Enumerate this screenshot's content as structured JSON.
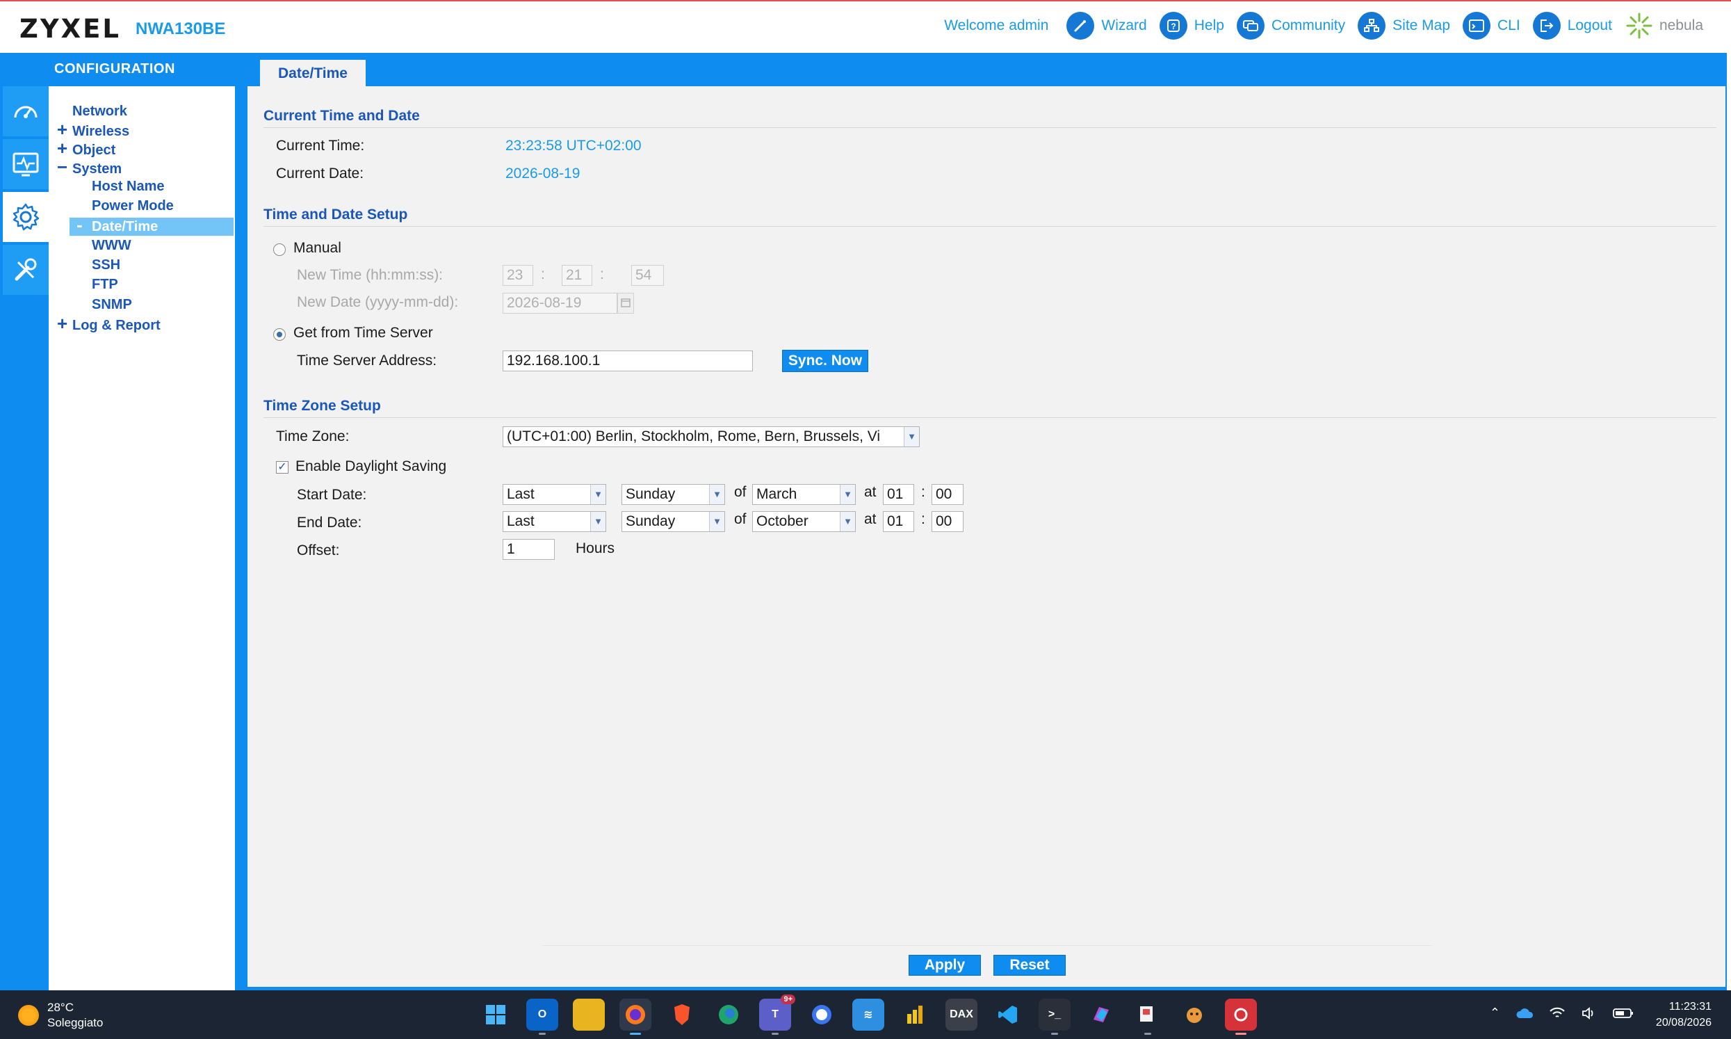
{
  "header": {
    "brand": "ZYXEL",
    "model": "NWA130BE",
    "welcome": "Welcome admin",
    "nav": [
      {
        "label": "Wizard",
        "icon": "wand-icon"
      },
      {
        "label": "Help",
        "icon": "help-icon"
      },
      {
        "label": "Community",
        "icon": "chat-icon"
      },
      {
        "label": "Site Map",
        "icon": "sitemap-icon"
      },
      {
        "label": "CLI",
        "icon": "terminal-icon"
      },
      {
        "label": "Logout",
        "icon": "logout-icon"
      }
    ],
    "nebula": "nebula"
  },
  "sidebar": {
    "title": "CONFIGURATION",
    "tree": [
      {
        "label": "Network",
        "sign": ""
      },
      {
        "label": "Wireless",
        "sign": "+"
      },
      {
        "label": "Object",
        "sign": "+"
      },
      {
        "label": "System",
        "sign": "−"
      },
      {
        "label": "Host Name",
        "sign": ""
      },
      {
        "label": "Power Mode",
        "sign": ""
      },
      {
        "label": "Date/Time",
        "sign": "-"
      },
      {
        "label": "WWW",
        "sign": ""
      },
      {
        "label": "SSH",
        "sign": ""
      },
      {
        "label": "FTP",
        "sign": ""
      },
      {
        "label": "SNMP",
        "sign": ""
      },
      {
        "label": "Log & Report",
        "sign": "+"
      }
    ]
  },
  "tab": "Date/Time",
  "current": {
    "section": "Current Time and Date",
    "time_label": "Current Time:",
    "time_value": "23:23:58 UTC+02:00",
    "date_label": "Current Date:",
    "date_value": "2026-08-19"
  },
  "setup": {
    "section": "Time and Date Setup",
    "manual_label": "Manual",
    "new_time_label": "New Time (hh:mm:ss):",
    "hh": "23",
    "mm": "21",
    "ss": "54",
    "new_date_label": "New Date (yyyy-mm-dd):",
    "new_date": "2026-08-19",
    "server_label": "Get from Time Server",
    "server_addr_label": "Time Server Address:",
    "server_addr": "192.168.100.1",
    "sync_button": "Sync. Now",
    "mode_selected": "server"
  },
  "timezone": {
    "section": "Time Zone Setup",
    "tz_label": "Time Zone:",
    "tz_value": "(UTC+01:00) Berlin, Stockholm, Rome, Bern, Brussels, Vi",
    "dst_label": "Enable Daylight Saving",
    "dst_checked": "✓",
    "start_label": "Start Date:",
    "start": {
      "week": "Last",
      "day": "Sunday",
      "month": "March",
      "hour": "01",
      "minute": "00"
    },
    "end_label": "End Date:",
    "end": {
      "week": "Last",
      "day": "Sunday",
      "month": "October",
      "hour": "01",
      "minute": "00"
    },
    "of": "of",
    "at": "at",
    "colon": ":",
    "offset_label": "Offset:",
    "offset_value": "1",
    "offset_unit": "Hours"
  },
  "buttons": {
    "apply": "Apply",
    "reset": "Reset"
  },
  "taskbar": {
    "temperature": "28°C",
    "weather": "Soleggiato",
    "time": "11:23:31",
    "date": "20/08/2026",
    "teams_badge": "9+",
    "colors": {
      "bg": "#1c2533",
      "accent": "#0f8cf0"
    }
  }
}
